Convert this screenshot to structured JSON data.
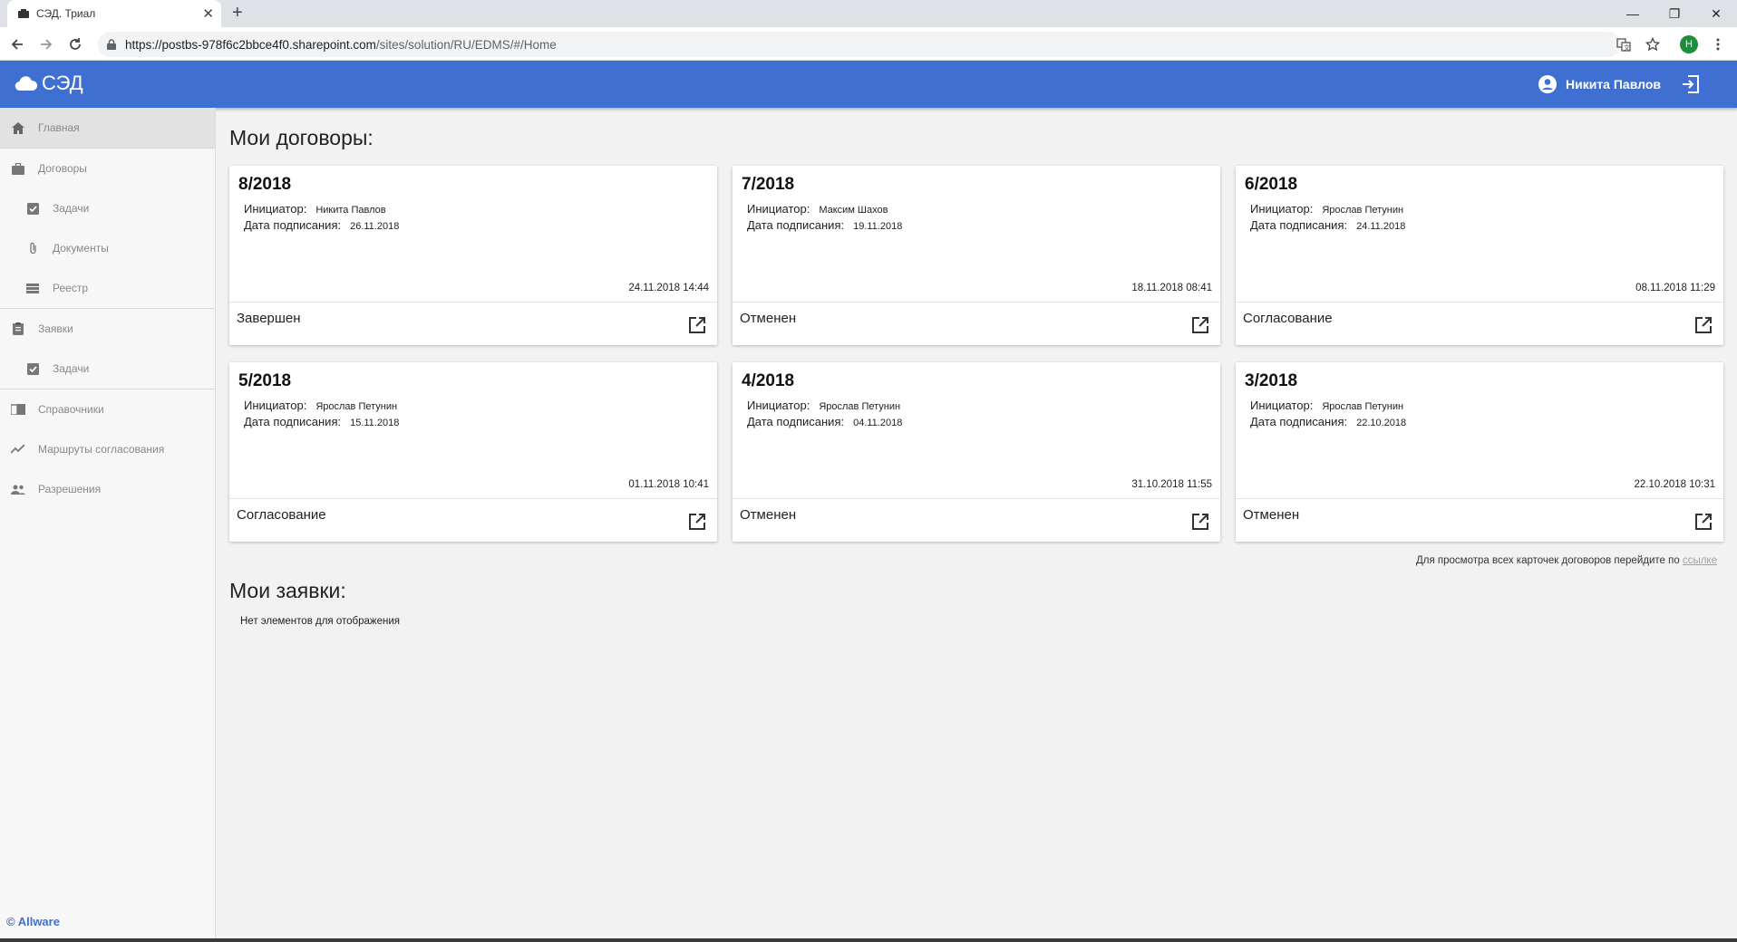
{
  "browser": {
    "tab_title": "СЭД. Триал",
    "url_host": "https://postbs-978f6c2bbce4f0.sharepoint.com",
    "url_path": "/sites/solution/RU/EDMS/#/Home",
    "profile_initial": "Н"
  },
  "header": {
    "brand": "СЭД",
    "user_name": "Никита Павлов"
  },
  "sidebar": {
    "items": [
      {
        "label": "Главная",
        "icon": "home-icon"
      },
      {
        "label": "Договоры",
        "icon": "briefcase-icon"
      },
      {
        "label": "Задачи",
        "icon": "checkbox-icon"
      },
      {
        "label": "Документы",
        "icon": "paperclip-icon"
      },
      {
        "label": "Реестр",
        "icon": "list-icon"
      },
      {
        "label": "Заявки",
        "icon": "clipboard-icon"
      },
      {
        "label": "Задачи",
        "icon": "checkbox-icon"
      },
      {
        "label": "Справочники",
        "icon": "book-icon"
      },
      {
        "label": "Маршруты согласования",
        "icon": "route-icon"
      },
      {
        "label": "Разрешения",
        "icon": "people-icon"
      }
    ],
    "copyright": "© Allware"
  },
  "main": {
    "contracts_title": "Мои договоры:",
    "initiator_label": "Инициатор:",
    "sign_date_label": "Дата подписания:",
    "cards": [
      {
        "number": "8/2018",
        "initiator": "Никита Павлов",
        "sign_date": "26.11.2018",
        "timestamp": "24.11.2018 14:44",
        "status": "Завершен"
      },
      {
        "number": "7/2018",
        "initiator": "Максим Шахов",
        "sign_date": "19.11.2018",
        "timestamp": "18.11.2018 08:41",
        "status": "Отменен"
      },
      {
        "number": "6/2018",
        "initiator": "Ярослав Петунин",
        "sign_date": "24.11.2018",
        "timestamp": "08.11.2018 11:29",
        "status": "Согласование"
      },
      {
        "number": "5/2018",
        "initiator": "Ярослав Петунин",
        "sign_date": "15.11.2018",
        "timestamp": "01.11.2018 10:41",
        "status": "Согласование"
      },
      {
        "number": "4/2018",
        "initiator": "Ярослав Петунин",
        "sign_date": "04.11.2018",
        "timestamp": "31.10.2018 11:55",
        "status": "Отменен"
      },
      {
        "number": "3/2018",
        "initiator": "Ярослав Петунин",
        "sign_date": "22.10.2018",
        "timestamp": "22.10.2018 10:31",
        "status": "Отменен"
      }
    ],
    "all_cards_text": "Для просмотра всех карточек договоров перейдите по",
    "all_cards_link": "ссылке",
    "requests_title": "Мои заявки:",
    "requests_empty": "Нет элементов для отображения"
  },
  "colors": {
    "header_blue": "#3f6fd1",
    "background": "#f2f2f2",
    "sidebar_active": "#e2e2e2"
  }
}
